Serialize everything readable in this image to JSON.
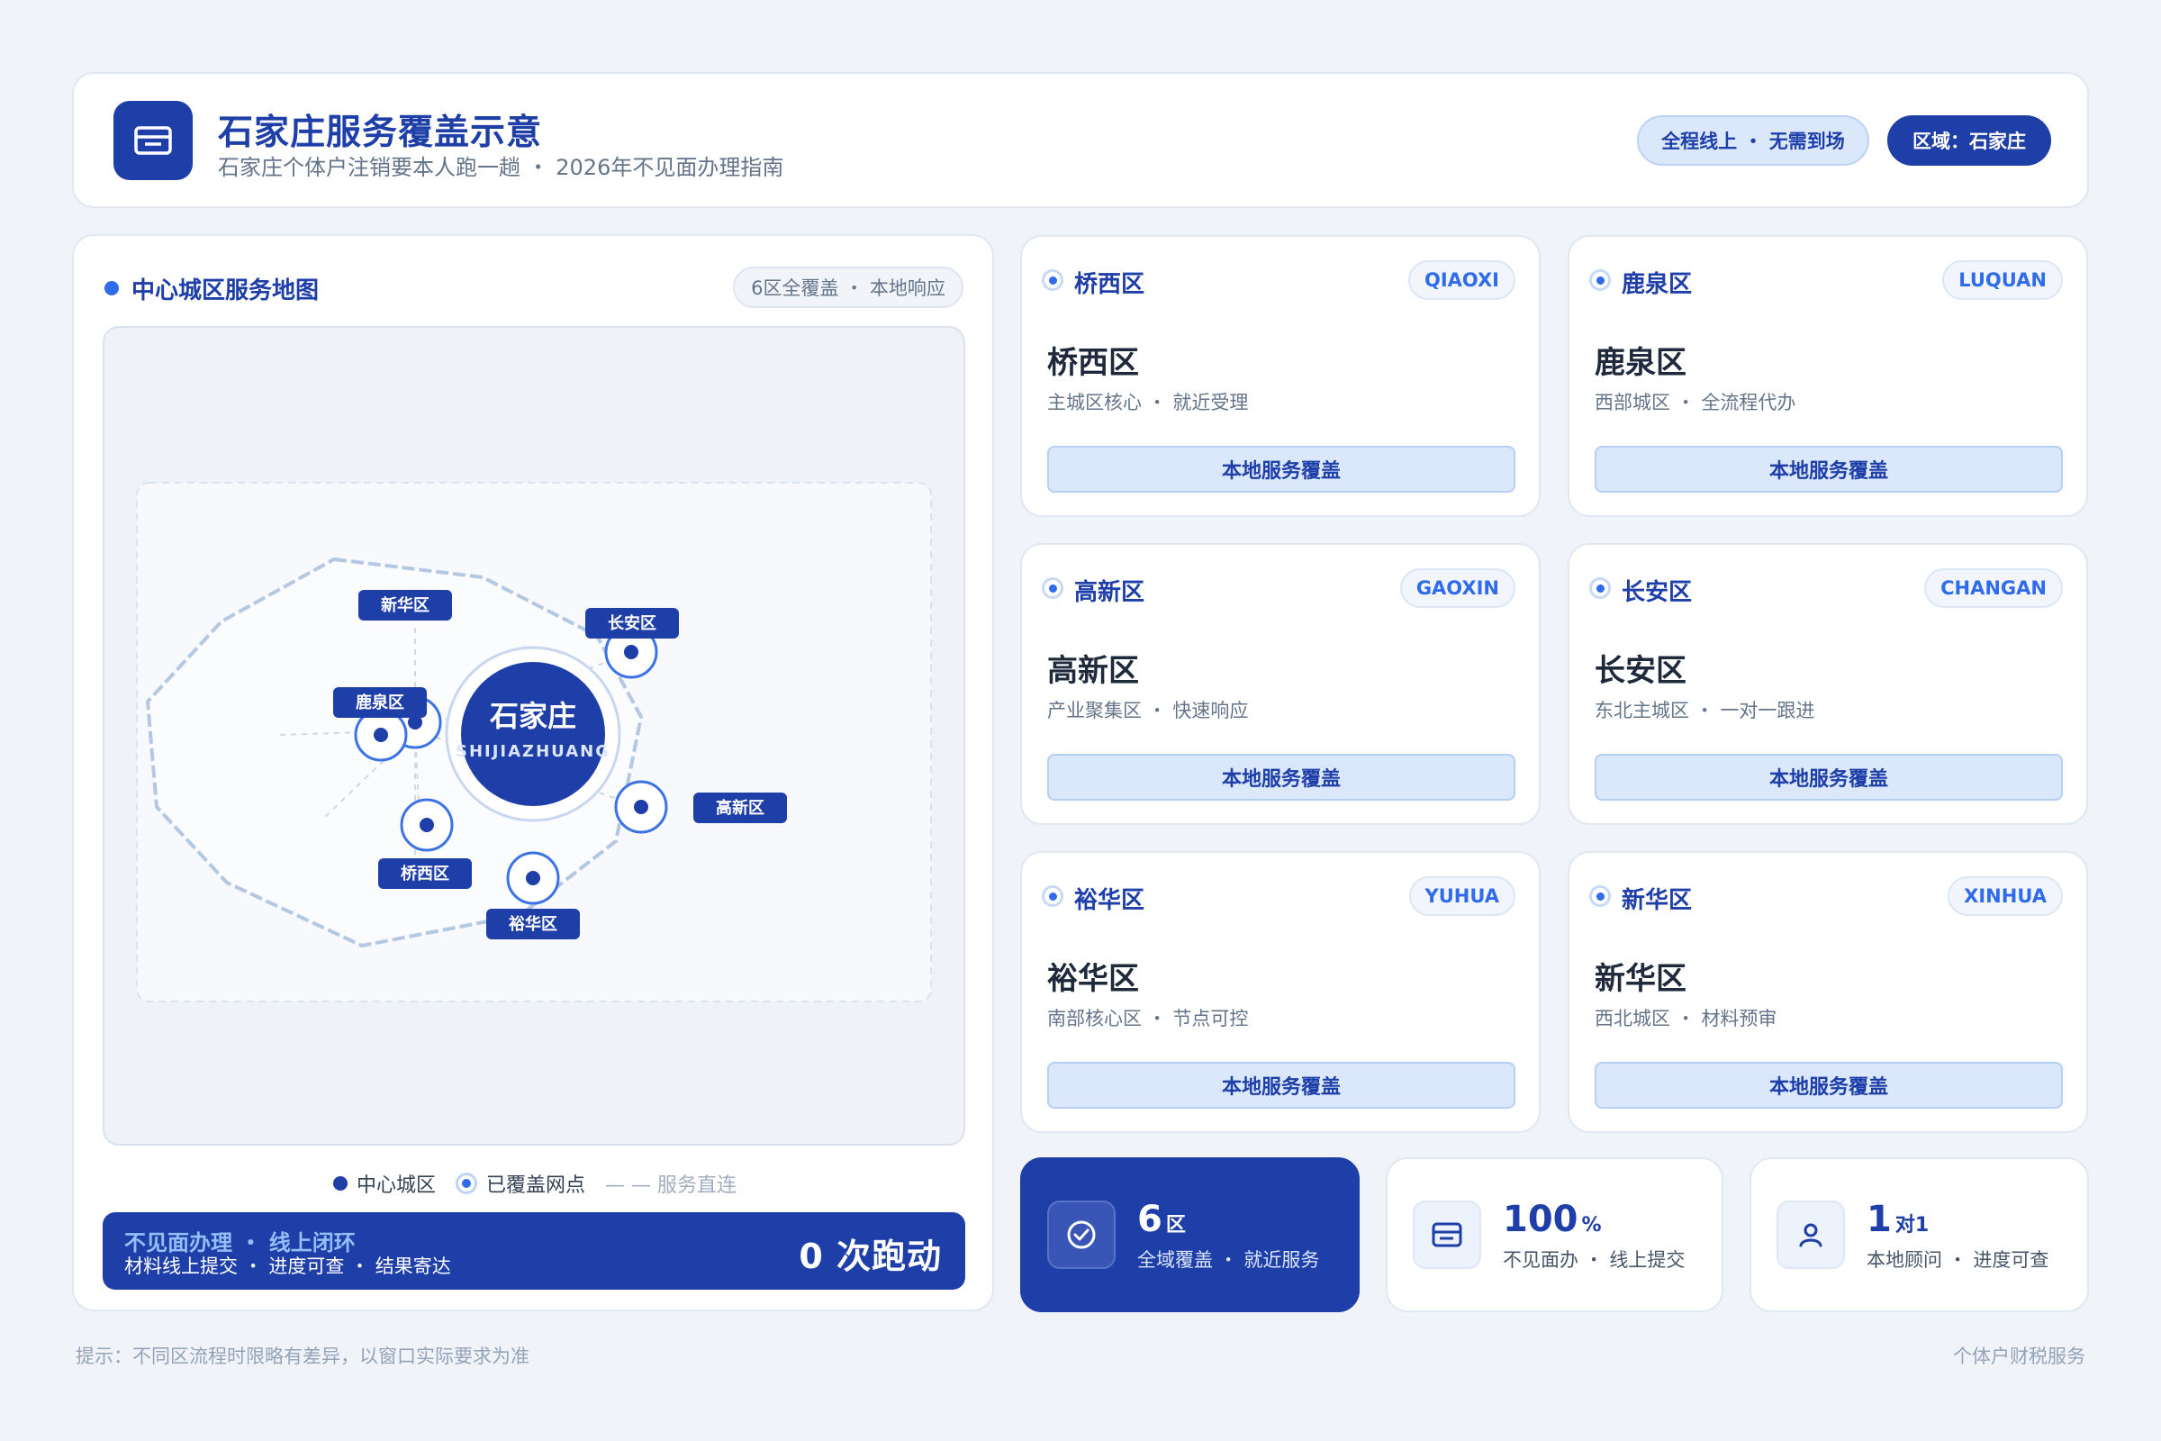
{
  "header": {
    "title": "石家庄服务覆盖示意",
    "subtitle": "石家庄个体户注销要本人跑一趟 ・ 2026年不见面办理指南",
    "pill_online": "全程线上 ・ 无需到场",
    "pill_region": "区域：石家庄",
    "icon": "card-icon"
  },
  "map_panel": {
    "title": "中心城区服务地图",
    "badge": "6区全覆盖 ・ 本地响应",
    "center": {
      "name": "石家庄",
      "pinyin": "SHIJIAZHUANG"
    },
    "nodes": [
      "新华区",
      "长安区",
      "鹿泉区",
      "高新区",
      "桥西区",
      "裕华区"
    ],
    "legend": {
      "center": "中心城区",
      "covered": "已覆盖网点",
      "direct": "— — 服务直连"
    },
    "banner": {
      "line1": "不见面办理 ・ 线上闭环",
      "line2": "材料线上提交 ・ 进度可查 ・ 结果寄达",
      "big": "0 次跑动"
    }
  },
  "districts": [
    {
      "name": "桥西区",
      "code": "QIAOXI",
      "desc": "主城区核心 ・ 就近受理",
      "button": "本地服务覆盖"
    },
    {
      "name": "鹿泉区",
      "code": "LUQUAN",
      "desc": "西部城区 ・ 全流程代办",
      "button": "本地服务覆盖"
    },
    {
      "name": "高新区",
      "code": "GAOXIN",
      "desc": "产业聚集区 ・ 快速响应",
      "button": "本地服务覆盖"
    },
    {
      "name": "长安区",
      "code": "CHANGAN",
      "desc": "东北主城区 ・ 一对一跟进",
      "button": "本地服务覆盖"
    },
    {
      "name": "裕华区",
      "code": "YUHUA",
      "desc": "南部核心区 ・ 节点可控",
      "button": "本地服务覆盖"
    },
    {
      "name": "新华区",
      "code": "XINHUA",
      "desc": "西北城区 ・ 材料预审",
      "button": "本地服务覆盖"
    }
  ],
  "stats": [
    {
      "num": "6",
      "unit": "区",
      "sub": "全域覆盖 ・ 就近服务",
      "icon": "check-circle-icon"
    },
    {
      "num": "100",
      "unit": "%",
      "sub": "不见面办 ・ 线上提交",
      "icon": "card-icon"
    },
    {
      "num": "1",
      "unit": "对1",
      "sub": "本地顾问 ・ 进度可查",
      "icon": "user-icon"
    }
  ],
  "footer": {
    "left": "提示：不同区流程时限略有差异，以窗口实际要求为准",
    "right": "个体户财税服务"
  },
  "colors": {
    "primary": "#1e3ea8",
    "accent": "#2f6bea",
    "light": "#dbe8fc"
  }
}
